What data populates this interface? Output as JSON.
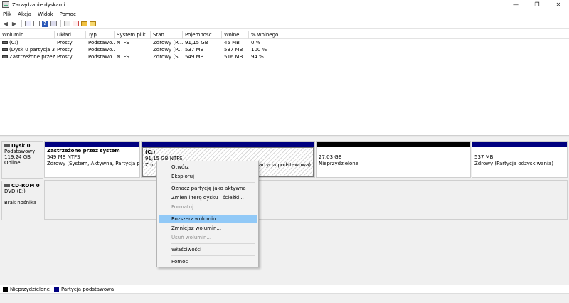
{
  "window": {
    "title": "Zarządzanie dyskami",
    "minimize_glyph": "—",
    "restore_glyph": "❐",
    "close_glyph": "✕"
  },
  "menubar": {
    "items": [
      "Plik",
      "Akcja",
      "Widok",
      "Pomoc"
    ]
  },
  "toolbar": {
    "back_glyph": "◀",
    "forward_glyph": "▶",
    "help_glyph": "?",
    "icons": [
      "back-icon",
      "forward-icon",
      "console-icon",
      "properties-icon",
      "help-icon",
      "list-icon",
      "connect-icon",
      "check-icon",
      "folder-icon",
      "folder-open-icon"
    ]
  },
  "volume_table": {
    "columns": [
      "Wolumin",
      "Układ",
      "Typ",
      "System plik...",
      "Stan",
      "Pojemność",
      "Wolne ...",
      "% wolnego"
    ],
    "rows": [
      [
        "(C:)",
        "Prosty",
        "Podstawo...",
        "NTFS",
        "Zdrowy (R...",
        "91,15 GB",
        "45 MB",
        "0 %"
      ],
      [
        "(Dysk 0 partycja 3)",
        "Prosty",
        "Podstawo...",
        "",
        "Zdrowy (P...",
        "537 MB",
        "537 MB",
        "100 %"
      ],
      [
        "Zastrzeżone przez ...",
        "Prosty",
        "Podstawo...",
        "NTFS",
        "Zdrowy (S...",
        "549 MB",
        "516 MB",
        "94 %"
      ]
    ]
  },
  "disks": {
    "disk0": {
      "name": "Dysk 0",
      "type": "Podstawowy",
      "size": "119,24 GB",
      "status": "Online",
      "partitions": [
        {
          "name": "Zastrzeżone przez system",
          "size": "549 MB NTFS",
          "status": "Zdrowy (System, Aktywna, Partycja podst"
        },
        {
          "name": "(C:)",
          "size": "91,15 GB NTFS",
          "status": "Zdrowy (Rozruch, Plik stronicowania, Zrzut awaryjny, Partycja podstawowa)",
          "status_visible_tail": "Partycja podstawowa)",
          "status_visible_head": "Zdrov"
        },
        {
          "name": "",
          "size": "27,03 GB",
          "status": "Nieprzydzielone"
        },
        {
          "name": "",
          "size": "537 MB",
          "status": "Zdrowy (Partycja odzyskiwania)"
        }
      ]
    },
    "cdrom0": {
      "name": "CD-ROM 0",
      "type": "DVD (E:)",
      "status": "Brak nośnika"
    }
  },
  "context_menu": {
    "items": [
      {
        "label": "Otwórz",
        "enabled": true
      },
      {
        "label": "Eksploruj",
        "enabled": true
      },
      {
        "label": "Oznacz partycję jako aktywną",
        "enabled": true
      },
      {
        "label": "Zmień literę dysku i ścieżki...",
        "enabled": true
      },
      {
        "label": "Formatuj...",
        "enabled": false
      },
      {
        "label": "Rozszerz wolumin...",
        "enabled": true,
        "highlighted": true
      },
      {
        "label": "Zmniejsz wolumin...",
        "enabled": true
      },
      {
        "label": "Usuń wolumin...",
        "enabled": false
      },
      {
        "label": "Właściwości",
        "enabled": true
      },
      {
        "label": "Pomoc",
        "enabled": true
      }
    ]
  },
  "legend": {
    "items": [
      {
        "label": "Nieprzydzielone",
        "color": "#000000"
      },
      {
        "label": "Partycja podstawowa",
        "color": "#000080"
      }
    ]
  },
  "colors": {
    "primary_partition": "#000080",
    "unallocated": "#000000",
    "menu_highlight": "#91c9f7"
  }
}
